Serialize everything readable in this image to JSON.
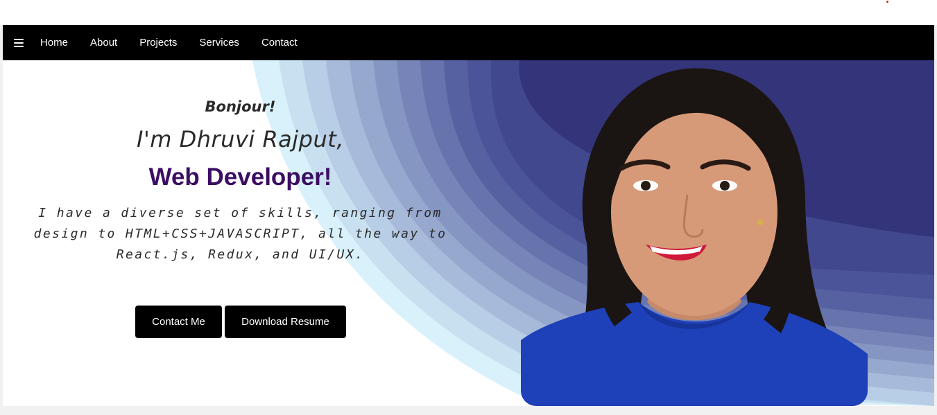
{
  "nav": {
    "menu_icon": "hamburger-menu-icon",
    "links": [
      "Home",
      "About",
      "Projects",
      "Services",
      "Contact"
    ]
  },
  "hero": {
    "greeting": "Bonjour!",
    "name_line": "I'm Dhruvi Rajput,",
    "role": "Web Developer!",
    "bio": "I have a diverse set of skills, ranging from design to HTML+CSS+JAVASCRIPT, all the way to React.js, Redux, and UI/UX.",
    "buttons": {
      "contact": "Contact Me",
      "resume": "Download Resume"
    },
    "portrait_alt": "portrait-photo"
  },
  "colors": {
    "nav_bg": "#000000",
    "role_text": "#3b0d63",
    "wave_light": "#d6f0fb",
    "wave_dark": "#33347a",
    "sweater": "#1e40b8"
  }
}
